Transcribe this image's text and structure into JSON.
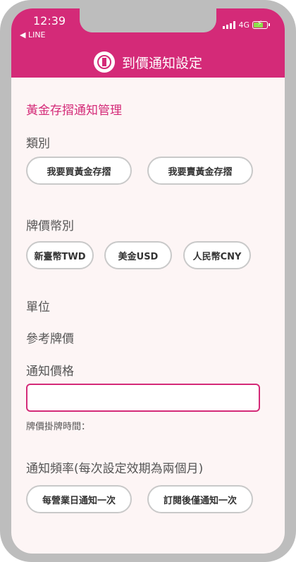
{
  "status_bar": {
    "time": "12:39",
    "back_app": "◀ LINE",
    "network": "4G"
  },
  "header": {
    "title": "到價通知設定"
  },
  "section": {
    "title": "黃金存摺通知管理"
  },
  "category": {
    "label": "類別",
    "options": [
      "我要買黃金存摺",
      "我要賣黃金存摺"
    ]
  },
  "currency": {
    "label": "牌價幣別",
    "options": [
      "新臺幣TWD",
      "美金USD",
      "人民幣CNY"
    ]
  },
  "unit": {
    "label": "單位"
  },
  "reference": {
    "label": "參考牌價"
  },
  "notify_price": {
    "label": "通知價格",
    "value": "",
    "placeholder": ""
  },
  "quote_time": {
    "label": "牌價掛牌時間："
  },
  "frequency": {
    "label": "通知頻率(每次設定效期為兩個月)",
    "options": [
      "每營業日通知一次",
      "訂閱後僅通知一次"
    ]
  },
  "colors": {
    "brand": "#d42a78",
    "background": "#fdf5f5"
  }
}
